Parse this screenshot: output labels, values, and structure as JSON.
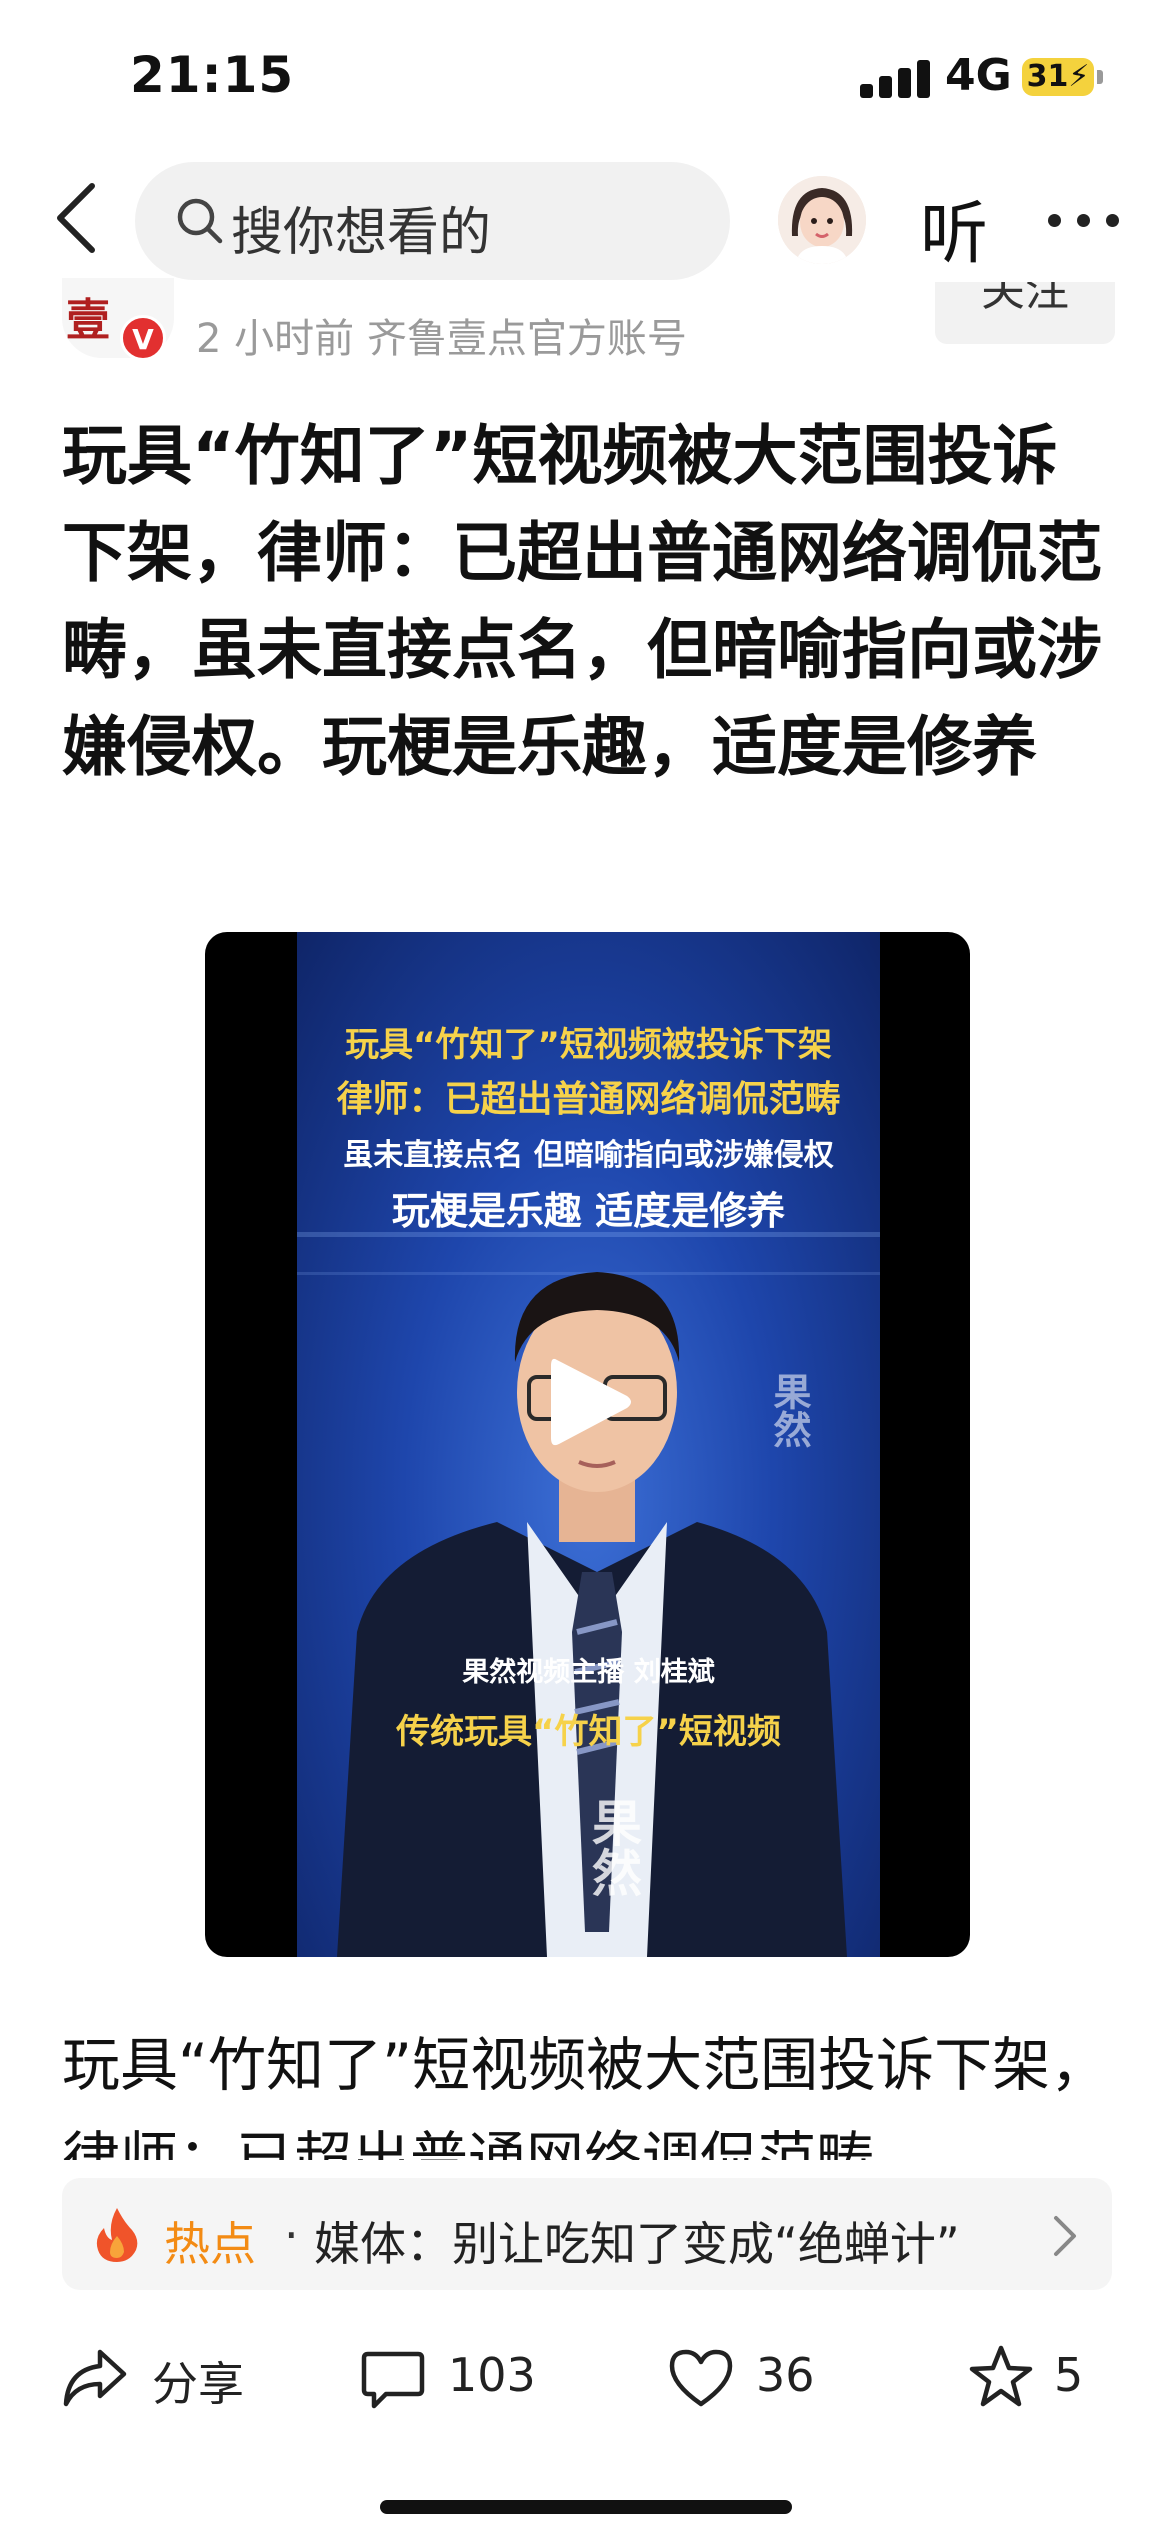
{
  "status_bar": {
    "time": "21:15",
    "network": "4G",
    "battery": "31"
  },
  "nav": {
    "search_placeholder": "搜你想看的",
    "listen_label": "听"
  },
  "post": {
    "author_logo": "壹",
    "verified_badge": "V",
    "meta": "2 小时前  齐鲁壹点官方账号",
    "follow_label": "关注",
    "headline": "玩具“竹知了”短视频被大范围投诉下架，律师：已超出普通网络调侃范畴，虽未直接点名，但暗喻指向或涉嫌侵权。玩梗是乐趣，适度是修养",
    "body_text": "玩具“竹知了”短视频被大范围投诉下架，律师：已超出普通网络调侃范畴"
  },
  "video": {
    "line1": "玩具“竹知了”短视频被投诉下架",
    "line2": "律师：已超出普通网络调侃范畴",
    "line3": "虽未直接点名 但暗喻指向或涉嫌侵权",
    "line4": "玩梗是乐趣 适度是修养",
    "anchor": "果然视频主播 刘桂斌",
    "caption": "传统玩具“竹知了”短视频",
    "watermark": "果然"
  },
  "hot_topic": {
    "label": "热点",
    "separator": "·",
    "text": "媒体：别让吃知了变成“绝蝉计”"
  },
  "actions": {
    "share_label": "分享",
    "comments": "103",
    "likes": "36",
    "stars": "5"
  },
  "colors": {
    "accent_orange": "#f38b14",
    "video_caption_yellow": "#f6d24a",
    "verified_red": "#e23030"
  }
}
